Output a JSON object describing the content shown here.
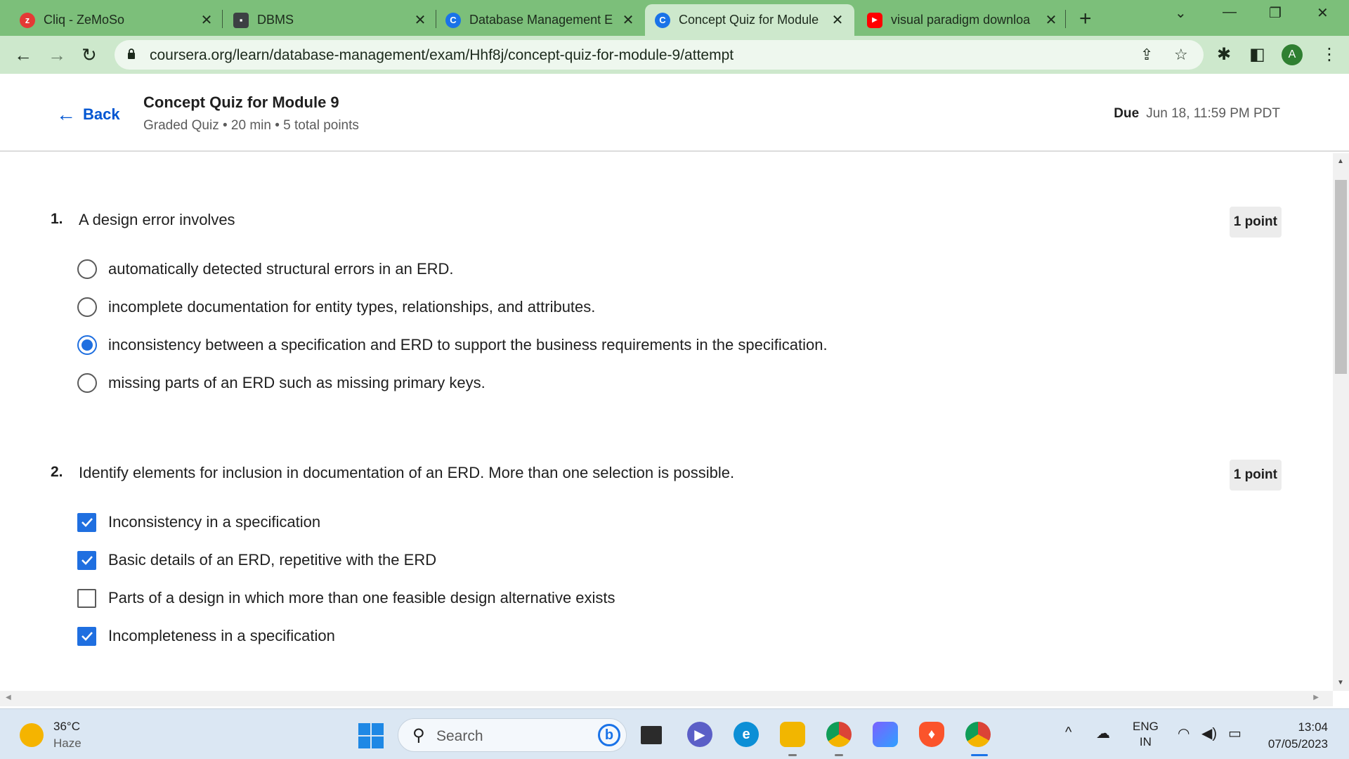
{
  "browser": {
    "tabs": [
      {
        "title": "Cliq - ZeMoSo",
        "icon": "zoho-cliq-icon",
        "color": "#e53935"
      },
      {
        "title": "DBMS",
        "icon": "contact-card-icon",
        "color": "#3c4043"
      },
      {
        "title": "Database Management E",
        "icon": "coursera-icon",
        "color": "#1a73e8"
      },
      {
        "title": "Concept Quiz for Module",
        "icon": "coursera-icon",
        "color": "#1a73e8",
        "active": true
      },
      {
        "title": "visual paradigm downloa",
        "icon": "youtube-icon",
        "color": "#ff0000"
      }
    ],
    "url": "coursera.org/learn/database-management/exam/Hhf8j/concept-quiz-for-module-9/attempt",
    "profile_initial": "A"
  },
  "header": {
    "back_label": "Back",
    "quiz_title": "Concept Quiz for Module 9",
    "quiz_subtitle": "Graded Quiz • 20 min • 5 total points",
    "due_label": "Due",
    "due_value": "Jun 18, 11:59 PM PDT"
  },
  "questions": [
    {
      "number": "1.",
      "text": "A design error involves",
      "points": "1 point",
      "type": "radio",
      "options": [
        {
          "label": "automatically detected structural errors in an ERD.",
          "selected": false
        },
        {
          "label": "incomplete documentation for entity types, relationships, and attributes.",
          "selected": false
        },
        {
          "label": "inconsistency between a specification and ERD to support the business requirements in the specification.",
          "selected": true
        },
        {
          "label": "missing parts of an ERD such as missing primary keys.",
          "selected": false
        }
      ]
    },
    {
      "number": "2.",
      "text": "Identify elements for inclusion in documentation of an ERD. More than one selection is possible.",
      "points": "1 point",
      "type": "checkbox",
      "options": [
        {
          "label": "Inconsistency in a specification",
          "selected": true
        },
        {
          "label": "Basic details of an ERD, repetitive with the ERD",
          "selected": true
        },
        {
          "label": "Parts of a design in which more than one feasible design alternative exists",
          "selected": false
        },
        {
          "label": "Incompleteness in a specification",
          "selected": true
        }
      ]
    }
  ],
  "taskbar": {
    "weather_temp": "36°C",
    "weather_desc": "Haze",
    "search_placeholder": "Search",
    "lang_top": "ENG",
    "lang_bottom": "IN",
    "time": "13:04",
    "date": "07/05/2023"
  },
  "colors": {
    "accent": "#0056d2",
    "selected": "#1f6fe0",
    "chrome": "#7cbf7a"
  }
}
